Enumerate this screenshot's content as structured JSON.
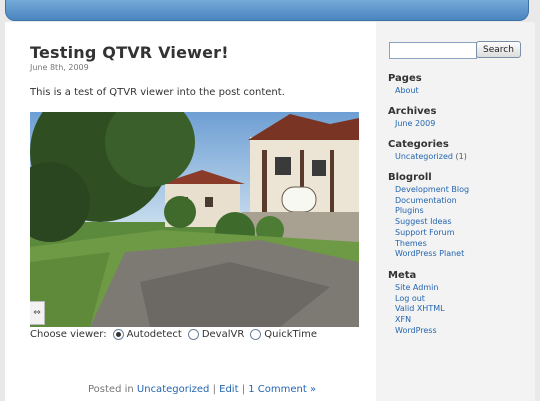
{
  "post": {
    "title": "Testing QTVR Viewer!",
    "date": "June 8th, 2009",
    "body": "This is a test of QTVR viewer into the post content.",
    "viewer_label": "Choose viewer:",
    "viewer_options": [
      "Autodetect",
      "DevalVR",
      "QuickTime"
    ],
    "selected_viewer": "Autodetect",
    "footer": {
      "posted_in": "Posted in",
      "category": "Uncategorized",
      "sep": "|",
      "edit": "Edit",
      "comments": "1 Comment »"
    }
  },
  "search": {
    "button": "Search",
    "value": ""
  },
  "sidebar": {
    "pages": {
      "title": "Pages",
      "items": [
        "About"
      ]
    },
    "archives": {
      "title": "Archives",
      "items": [
        "June 2009"
      ]
    },
    "categories": {
      "title": "Categories",
      "items": [
        {
          "label": "Uncategorized",
          "count": "(1)"
        }
      ]
    },
    "blogroll": {
      "title": "Blogroll",
      "items": [
        "Development Blog",
        "Documentation",
        "Plugins",
        "Suggest Ideas",
        "Support Forum",
        "Themes",
        "WordPress Planet"
      ]
    },
    "meta": {
      "title": "Meta",
      "items": [
        "Site Admin",
        "Log out",
        "Valid XHTML",
        "XFN",
        "WordPress"
      ]
    }
  },
  "colors": {
    "link": "#2465b0",
    "header": "#4a85c0"
  },
  "icons": {
    "pano_control": "arrows-icon"
  }
}
